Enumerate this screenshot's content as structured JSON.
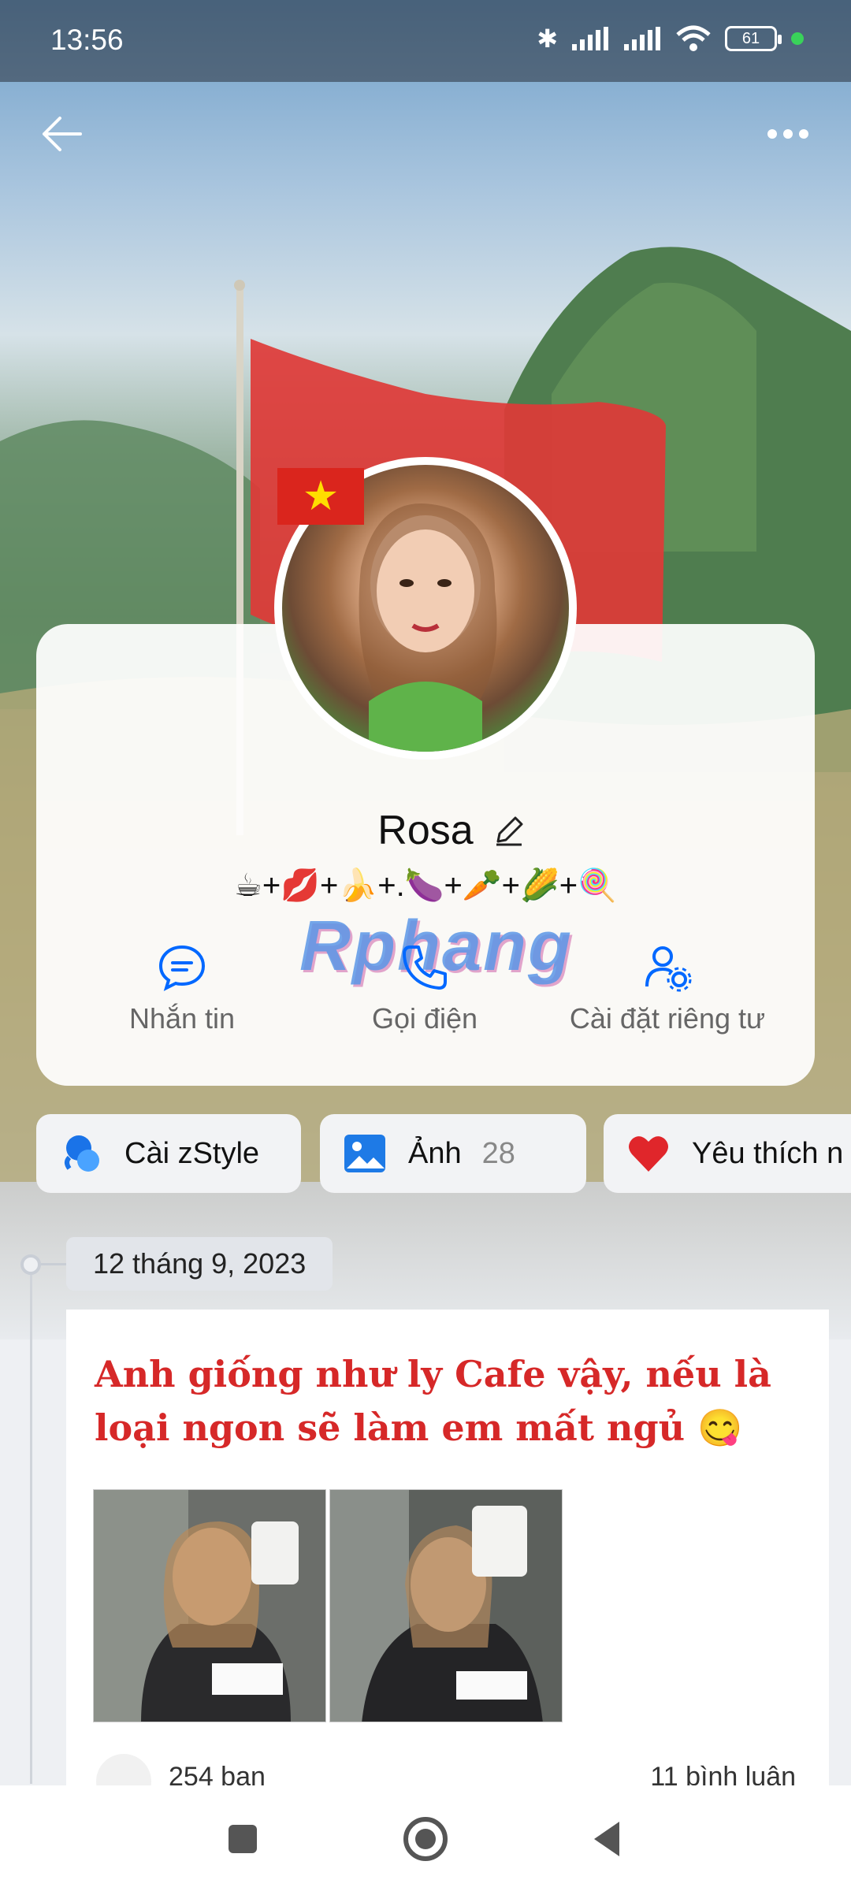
{
  "status_bar": {
    "time": "13:56",
    "battery": "61"
  },
  "profile": {
    "name": "Rosa",
    "bio": "☕+💋+🍌+.🍆+🥕+🌽+🍭",
    "watermark": "Rphang"
  },
  "actions": [
    {
      "label": "Nhắn tin",
      "icon": "chat-bubble-icon"
    },
    {
      "label": "Gọi điện",
      "icon": "phone-icon"
    },
    {
      "label": "Cài đặt riêng tư",
      "icon": "user-settings-icon"
    }
  ],
  "chips": [
    {
      "label": "Cài zStyle",
      "icon": "zstyle-icon"
    },
    {
      "label": "Ảnh",
      "count": "28",
      "icon": "photo-icon"
    },
    {
      "label": "Yêu thích n",
      "icon": "heart-icon"
    }
  ],
  "timeline": {
    "date": "12 tháng 9, 2023",
    "post": {
      "text": "Anh giống như ly Cafe vậy, nếu là loại ngon sẽ làm em mất ngủ 😋",
      "likes": "254 bạn",
      "comments": "11 bình luận"
    }
  },
  "colors": {
    "accent": "#0068ff",
    "post_text": "#d62828",
    "heart": "#e0262b"
  }
}
